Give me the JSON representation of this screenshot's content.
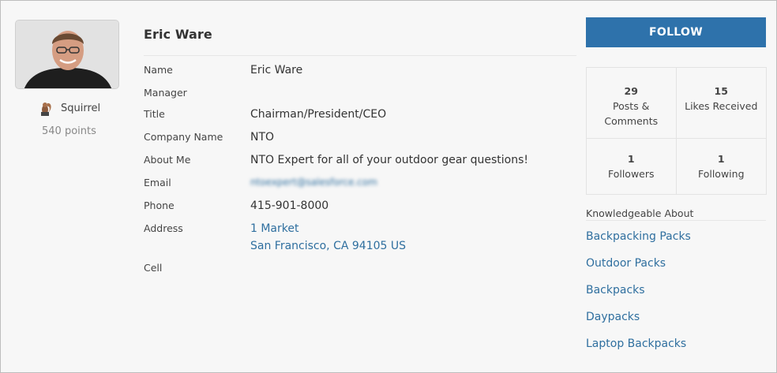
{
  "profile": {
    "name": "Eric Ware",
    "rank": "Squirrel",
    "points": "540 points"
  },
  "fields": [
    {
      "label": "Name",
      "value": "Eric Ware"
    },
    {
      "label": "Manager",
      "value": ""
    },
    {
      "label": "Title",
      "value": "Chairman/President/CEO"
    },
    {
      "label": "Company Name",
      "value": "NTO"
    },
    {
      "label": "About Me",
      "value": "NTO Expert for all of your outdoor gear questions!"
    },
    {
      "label": "Email",
      "value": "ntoexpert@salesforce.com"
    },
    {
      "label": "Phone",
      "value": "415-901-8000"
    },
    {
      "label": "Address",
      "line1": "1 Market",
      "line2": "San Francisco, CA 94105 US"
    },
    {
      "label": "Cell",
      "value": ""
    }
  ],
  "follow_label": "FOLLOW",
  "stats": [
    {
      "num": "29",
      "label": "Posts & Comments"
    },
    {
      "num": "15",
      "label": "Likes Received"
    },
    {
      "num": "1",
      "label": "Followers"
    },
    {
      "num": "1",
      "label": "Following"
    }
  ],
  "knowledge": {
    "title": "Knowledgeable About",
    "topics": [
      "Backpacking Packs",
      "Outdoor Packs",
      "Backpacks",
      "Daypacks",
      "Laptop Backpacks"
    ]
  },
  "colors": {
    "accent": "#2e72ab",
    "link": "#2f6f9f"
  }
}
